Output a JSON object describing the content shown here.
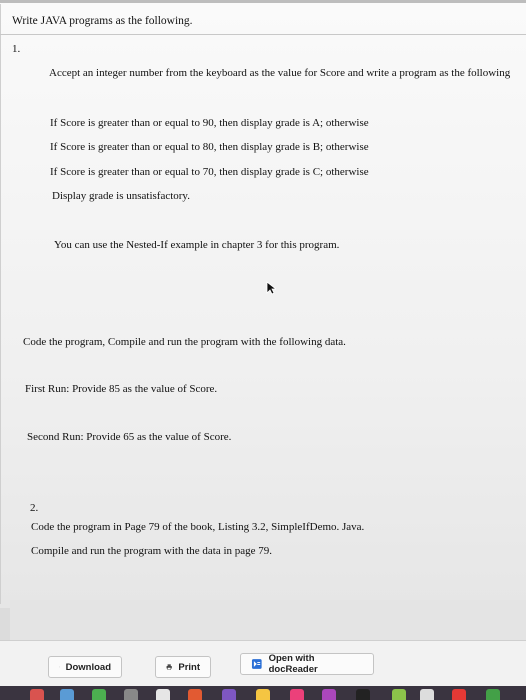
{
  "document": {
    "heading": "Write JAVA programs as the following.",
    "item1_number": "1.",
    "intro": "Accept an integer number from the keyboard as the value for Score and write a program as the following",
    "rules": [
      "If Score is greater than or equal to 90, then display grade is A; otherwise",
      "If Score is greater than or equal to 80, then display grade is B; otherwise",
      "If Score is greater than or equal to 70, then display grade is C; otherwise",
      "Display grade is unsatisfactory."
    ],
    "hint": "You can use the Nested-If example in chapter 3 for this program.",
    "code_instruction": "Code the program, Compile and run the program with the following data.",
    "first_run": "First Run: Provide 85 as the value of Score.",
    "second_run": "Second Run: Provide 65 as the value of Score.",
    "item2_number": "2.",
    "item2_line1": "Code the program in Page 79 of the book, Listing 3.2, SimpleIfDemo. Java.",
    "item2_line2": "Compile and run the program with the data in page 79."
  },
  "toolbar": {
    "download_label": "Download",
    "print_label": "Print",
    "open_label": "Open with docReader"
  },
  "colors": {
    "accent": "#2a6fd6",
    "dock": "#3a3440"
  },
  "icons": [
    "download-icon",
    "print-icon",
    "docreader-icon",
    "mouse-cursor-icon"
  ]
}
